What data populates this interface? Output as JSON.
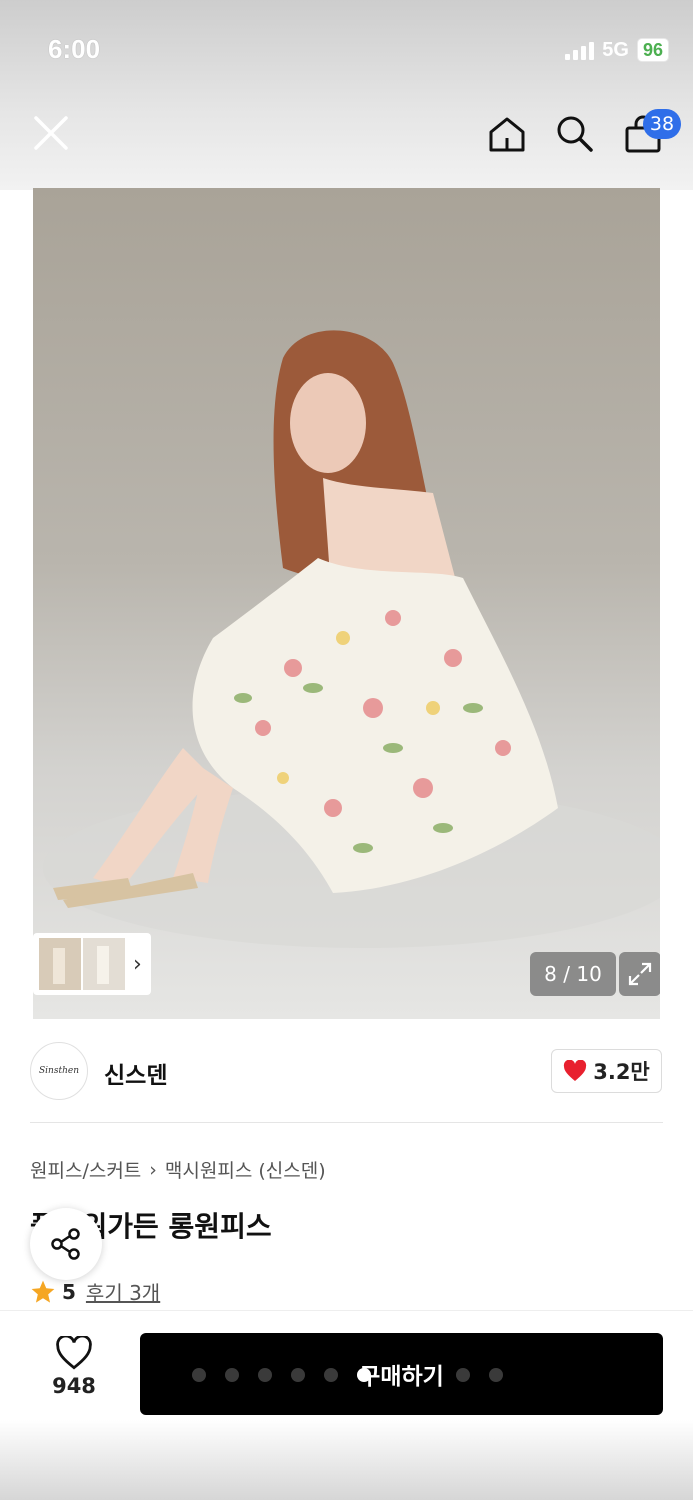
{
  "status": {
    "time": "6:00",
    "network": "5G",
    "battery": "96"
  },
  "nav": {
    "cart_count": "38"
  },
  "gallery": {
    "counter": "8 / 10",
    "total": 10,
    "current": 8
  },
  "brand": {
    "name": "신스덴",
    "logo_text": "Sinsthen",
    "likes": "3.2만"
  },
  "product": {
    "breadcrumb": [
      "원피스/스커트",
      "맥시원피스 (신스덴)"
    ],
    "title": "플라워가든 롱원피스",
    "rating": "5",
    "review_link": "후기 3개"
  },
  "bottom": {
    "wish_count": "948",
    "buy_label": "구매하기"
  },
  "colors": {
    "accent": "#2f6ee9",
    "heart": "#e8202e",
    "star": "#f5a623",
    "buy_bg": "#000000"
  },
  "icons": [
    "close-icon",
    "home-icon",
    "search-icon",
    "bag-icon",
    "chevron-right-icon",
    "expand-icon",
    "heart-icon",
    "share-icon",
    "star-icon"
  ]
}
